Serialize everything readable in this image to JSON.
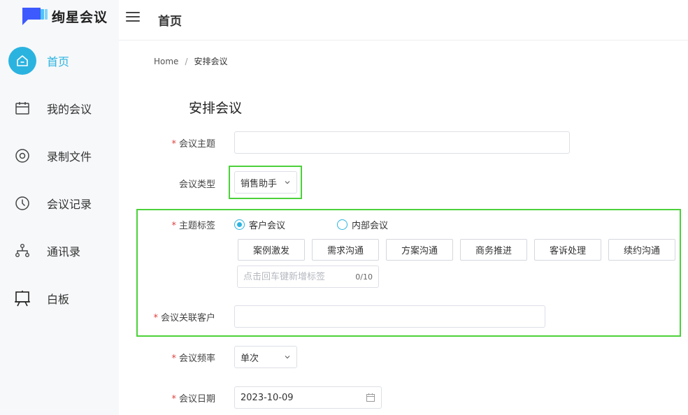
{
  "app": {
    "name": "绚星会议"
  },
  "sidebar": {
    "items": [
      {
        "label": "首页",
        "icon": "home-icon",
        "active": true
      },
      {
        "label": "我的会议",
        "icon": "calendar-icon",
        "active": false
      },
      {
        "label": "录制文件",
        "icon": "record-icon",
        "active": false
      },
      {
        "label": "会议记录",
        "icon": "clock-icon",
        "active": false
      },
      {
        "label": "通讯录",
        "icon": "org-chart-icon",
        "active": false
      },
      {
        "label": "白板",
        "icon": "whiteboard-icon",
        "active": false
      }
    ]
  },
  "header": {
    "title": "首页"
  },
  "breadcrumb": {
    "home": "Home",
    "separator": "/",
    "current": "安排会议"
  },
  "form": {
    "title": "安排会议",
    "topic": {
      "label": "会议主题",
      "required": true,
      "value": "",
      "placeholder": ""
    },
    "type": {
      "label": "会议类型",
      "value": "销售助手"
    },
    "tags": {
      "label": "主题标签",
      "required": true,
      "radio_options": [
        {
          "label": "客户会议",
          "checked": true
        },
        {
          "label": "内部会议",
          "checked": false
        }
      ],
      "preset_tags": [
        "案例激发",
        "需求沟通",
        "方案沟通",
        "商务推进",
        "客诉处理",
        "续约沟通"
      ],
      "new_tag_placeholder": "点击回车键新增标签",
      "counter": "0/10"
    },
    "customer": {
      "label": "会议关联客户",
      "required": true,
      "value": ""
    },
    "frequency": {
      "label": "会议频率",
      "required": true,
      "value": "单次"
    },
    "date": {
      "label": "会议日期",
      "required": true,
      "value": "2023-10-09"
    }
  },
  "colors": {
    "accent": "#2bb3e0",
    "highlight_box": "#4cd13a",
    "required": "#e0413e",
    "brand": "#3d5afe"
  }
}
